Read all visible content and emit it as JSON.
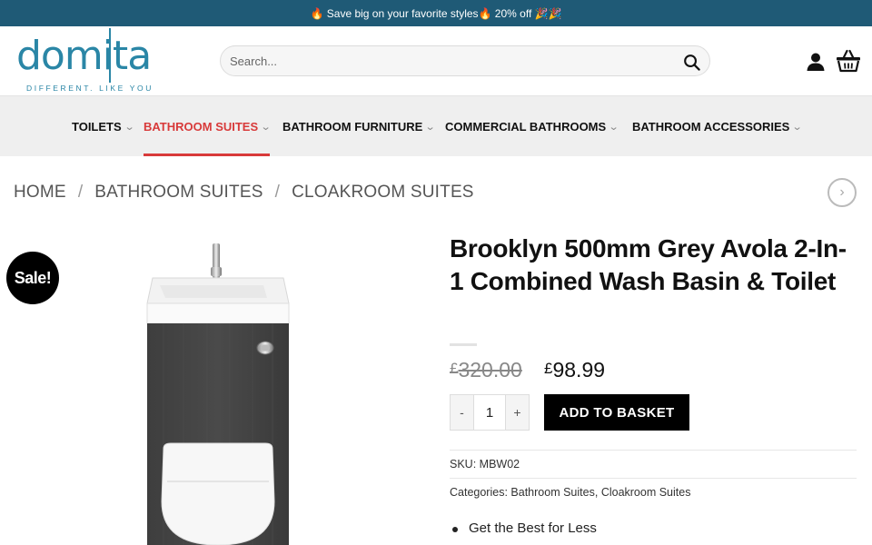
{
  "promo": {
    "text": "🔥 Save big on your favorite styles🔥 20% off 🎉🎉"
  },
  "header": {
    "logo_text": "domita",
    "logo_tagline": "DIFFERENT. LIKE YOU",
    "search_placeholder": "Search...",
    "icons": {
      "search": "search-icon",
      "account": "user-icon",
      "basket": "basket-icon"
    }
  },
  "nav": {
    "items": [
      {
        "label": "TOILETS"
      },
      {
        "label": "BATHROOM SUITES"
      },
      {
        "label": "BATHROOM FURNITURE"
      },
      {
        "label": "COMMERCIAL BATHROOMS"
      },
      {
        "label": "BATHROOM ACCESSORIES"
      }
    ],
    "active_color": "#d83a3a"
  },
  "breadcrumb": {
    "items": [
      {
        "label": "HOME"
      },
      {
        "label": "BATHROOM SUITES"
      },
      {
        "label": "CLOAKROOM SUITES"
      }
    ],
    "separator": "/"
  },
  "product": {
    "sale_badge": "Sale!",
    "title": "Brooklyn 500mm Grey Avola 2-In-1 Combined Wash Basin & Toilet",
    "currency": "£",
    "old_price": "320.00",
    "new_price": "98.99",
    "quantity": "1",
    "minus_label": "-",
    "plus_label": "+",
    "add_to_basket": "ADD TO BASKET",
    "sku_label": "SKU:",
    "sku": "MBW02",
    "categories_label": "Categories:",
    "categories": [
      {
        "label": "Bathroom Suites"
      },
      {
        "label": "Cloakroom Suites"
      }
    ],
    "category_separator": ",",
    "highlights": [
      {
        "label": "Get the Best for Less"
      }
    ]
  },
  "colors": {
    "promo_bar": "#1f5a76",
    "brand": "#2a86a6",
    "nav_bg": "#efefef",
    "accent_red": "#d83a3a",
    "button": "#000000"
  }
}
